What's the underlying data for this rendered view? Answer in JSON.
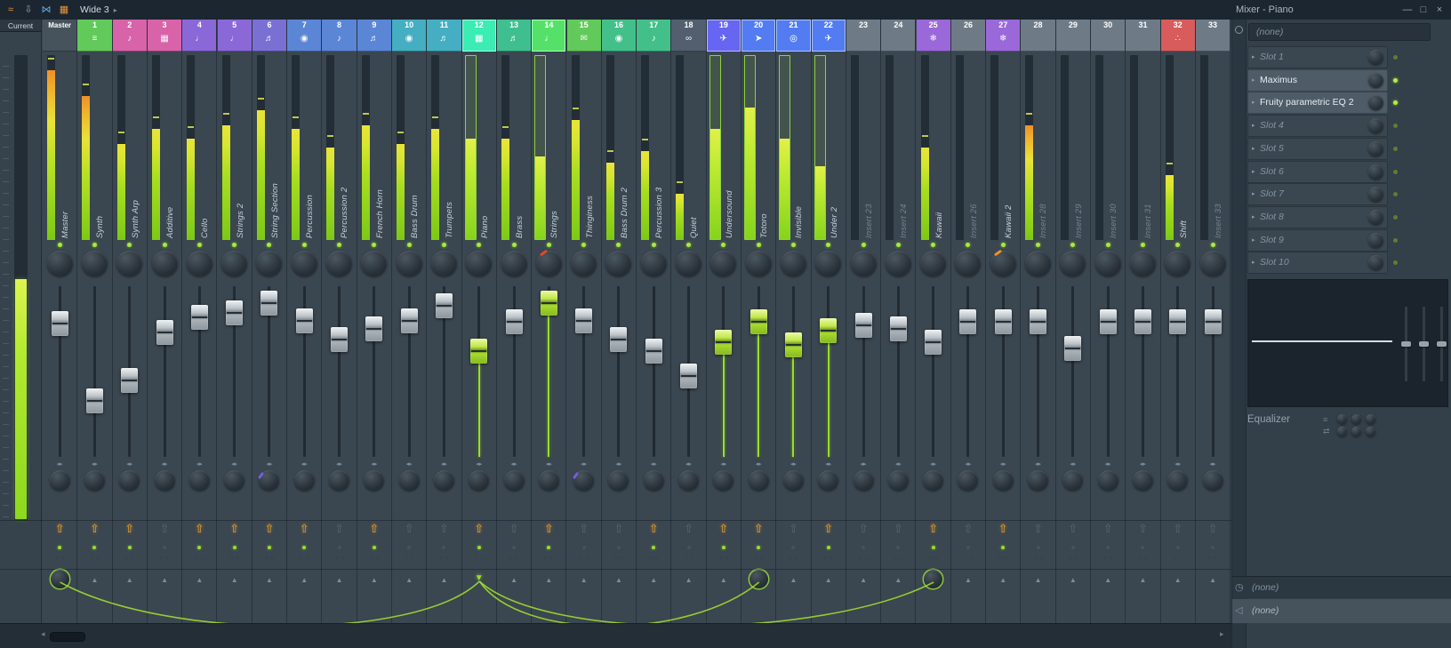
{
  "titlebar": {
    "preset": "Wide 3",
    "caret": "▸",
    "title": "Mixer - Piano",
    "tools": [
      {
        "name": "fl-logo-icon",
        "glyph": "≈",
        "color": "#e8953a"
      },
      {
        "name": "save-icon",
        "glyph": "⇩",
        "color": "#93a1ac"
      },
      {
        "name": "detach-icon",
        "glyph": "⋈",
        "color": "#64a8e0"
      },
      {
        "name": "layout-icon",
        "glyph": "▦",
        "color": "#e8953a"
      }
    ],
    "buttons": [
      {
        "name": "minimize-button",
        "glyph": "—"
      },
      {
        "name": "maximize-button",
        "glyph": "□"
      },
      {
        "name": "close-button",
        "glyph": "×"
      }
    ]
  },
  "colors": {
    "accent_green": "#9ade2e",
    "armed_orange": "#f2a32c",
    "cable_green": "#a6e22e",
    "selected_tab": "#35d4a0"
  },
  "current": {
    "label": "Current"
  },
  "channels": [
    {
      "num": "Master",
      "name": "Master",
      "color": "#46525c",
      "icon": "master-channel-icon",
      "glyph": "",
      "meter": 0.92,
      "hot": true,
      "fader": 0.83,
      "armed": true,
      "route": "knob"
    },
    {
      "num": "1",
      "name": "Synth",
      "color": "#62c95b",
      "icon": "synth-icon",
      "glyph": "≡",
      "meter": 0.78,
      "hot": true,
      "fader": 0.3,
      "armed": true
    },
    {
      "num": "2",
      "name": "Synth Arp",
      "color": "#d863a8",
      "icon": "arp-icon",
      "glyph": "♪",
      "meter": 0.52,
      "fader": 0.44,
      "armed": true
    },
    {
      "num": "3",
      "name": "Additive",
      "color": "#d863a8",
      "icon": "sequencer-icon",
      "glyph": "▦",
      "meter": 0.6,
      "fader": 0.77
    },
    {
      "num": "4",
      "name": "Cello",
      "color": "#8a68d8",
      "icon": "cello-icon",
      "glyph": "♩",
      "meter": 0.55,
      "fader": 0.87,
      "armed": true
    },
    {
      "num": "5",
      "name": "Strings 2",
      "color": "#8a68d8",
      "icon": "strings-icon",
      "glyph": "♩",
      "meter": 0.62,
      "fader": 0.9,
      "armed": true
    },
    {
      "num": "6",
      "name": "String Section",
      "color": "#7a70d4",
      "icon": "strings-icon",
      "glyph": "♬",
      "meter": 0.7,
      "fader": 0.97,
      "armed": true,
      "sep_mark": true
    },
    {
      "num": "7",
      "name": "Percussion",
      "color": "#5b86d6",
      "icon": "drum-icon",
      "glyph": "◉",
      "meter": 0.6,
      "fader": 0.85,
      "armed": true
    },
    {
      "num": "8",
      "name": "Percussion 2",
      "color": "#5b86d6",
      "icon": "percussion-icon",
      "glyph": "♪",
      "meter": 0.5,
      "fader": 0.72
    },
    {
      "num": "9",
      "name": "French Horn",
      "color": "#5b86d6",
      "icon": "horn-icon",
      "glyph": "♬",
      "meter": 0.62,
      "fader": 0.79,
      "armed": true
    },
    {
      "num": "10",
      "name": "Bass Drum",
      "color": "#45aec2",
      "icon": "drum-icon",
      "glyph": "◉",
      "meter": 0.52,
      "fader": 0.85
    },
    {
      "num": "11",
      "name": "Trumpets",
      "color": "#45aec2",
      "icon": "horn-icon",
      "glyph": "♬",
      "meter": 0.6,
      "fader": 0.95
    },
    {
      "num": "12",
      "name": "Piano",
      "color": "#35d4a0",
      "icon": "piano-icon",
      "glyph": "▦",
      "meter": 0.55,
      "selected": true,
      "fader": 0.64,
      "green": true,
      "armed": true,
      "route": "source"
    },
    {
      "num": "13",
      "name": "Brass",
      "color": "#3fbf8f",
      "icon": "horn-icon",
      "glyph": "♬",
      "meter": 0.55,
      "fader": 0.84
    },
    {
      "num": "14",
      "name": "Strings",
      "color": "#4cc95e",
      "icon": "strings-icon",
      "glyph": "♩",
      "meter": 0.45,
      "selected": true,
      "fader": 0.97,
      "green": true,
      "armed": true,
      "pan_mark": "#e04a28"
    },
    {
      "num": "15",
      "name": "Thinginess",
      "color": "#62c95b",
      "icon": "speech-icon",
      "glyph": "✉",
      "meter": 0.65,
      "fader": 0.85,
      "sep_mark": true
    },
    {
      "num": "16",
      "name": "Bass Drum 2",
      "color": "#43c08a",
      "icon": "drum-icon",
      "glyph": "◉",
      "meter": 0.42,
      "fader": 0.72
    },
    {
      "num": "17",
      "name": "Percussion 3",
      "color": "#43c08a",
      "icon": "percussion-icon",
      "glyph": "♪",
      "meter": 0.48,
      "fader": 0.64,
      "armed": true
    },
    {
      "num": "18",
      "name": "Quiet",
      "color": "#535f6e",
      "icon": "link-icon",
      "glyph": "∞",
      "meter": 0.25,
      "fader": 0.47
    },
    {
      "num": "19",
      "name": "Undersound",
      "color": "#5b5bd8",
      "icon": "plane-icon",
      "glyph": "✈",
      "meter": 0.6,
      "selected": true,
      "fader": 0.7,
      "green": true,
      "armed": true
    },
    {
      "num": "20",
      "name": "Totoro",
      "color": "#4a6fd8",
      "icon": "hand-icon",
      "glyph": "➤",
      "meter": 0.72,
      "selected": true,
      "fader": 0.84,
      "green": true,
      "armed": true,
      "route": "knob"
    },
    {
      "num": "21",
      "name": "Invisible",
      "color": "#4a6fd8",
      "icon": "eye-icon",
      "glyph": "◎",
      "meter": 0.55,
      "selected": true,
      "fader": 0.68,
      "green": true
    },
    {
      "num": "22",
      "name": "Under 2",
      "color": "#4a6fd8",
      "icon": "plane-icon",
      "glyph": "✈",
      "meter": 0.4,
      "selected": true,
      "fader": 0.78,
      "green": true,
      "armed": true
    },
    {
      "num": "23",
      "name": "Insert 23",
      "color": "#6e7b87",
      "icon": "",
      "glyph": "",
      "meter": 0,
      "fader": 0.82,
      "dim": true
    },
    {
      "num": "24",
      "name": "Insert 24",
      "color": "#6e7b87",
      "icon": "",
      "glyph": "",
      "meter": 0,
      "fader": 0.79,
      "dim": true
    },
    {
      "num": "25",
      "name": "Kawaii",
      "color": "#9a68d8",
      "icon": "snowflake-icon",
      "glyph": "❄",
      "meter": 0.5,
      "fader": 0.7,
      "armed": true,
      "route": "knob"
    },
    {
      "num": "26",
      "name": "Insert 26",
      "color": "#6e7b87",
      "icon": "",
      "glyph": "",
      "meter": 0,
      "fader": 0.84,
      "dim": true
    },
    {
      "num": "27",
      "name": "Kawaii 2",
      "color": "#9a68d8",
      "icon": "snowflake-icon",
      "glyph": "❄",
      "meter": 0,
      "fader": 0.84,
      "armed": true,
      "pan_mark": "#f09028"
    },
    {
      "num": "28",
      "name": "Insert 28",
      "color": "#6e7b87",
      "icon": "",
      "glyph": "",
      "meter": 0.62,
      "hot": true,
      "fader": 0.84,
      "dim": true
    },
    {
      "num": "29",
      "name": "Insert 29",
      "color": "#6e7b87",
      "icon": "",
      "glyph": "",
      "meter": 0,
      "fader": 0.66,
      "dim": true
    },
    {
      "num": "30",
      "name": "Insert 30",
      "color": "#6e7b87",
      "icon": "",
      "glyph": "",
      "meter": 0,
      "fader": 0.84,
      "dim": true
    },
    {
      "num": "31",
      "name": "Insert 31",
      "color": "#6e7b87",
      "icon": "",
      "glyph": "",
      "meter": 0,
      "fader": 0.84,
      "dim": true
    },
    {
      "num": "32",
      "name": "Shift",
      "color": "#d85c5c",
      "icon": "dots-icon",
      "glyph": "∴",
      "meter": 0.35,
      "fader": 0.84
    },
    {
      "num": "33",
      "name": "Insert 33",
      "color": "#6e7b87",
      "icon": "",
      "glyph": "",
      "meter": 0,
      "fader": 0.84,
      "dim": true
    }
  ],
  "sends": [
    {
      "from": 12,
      "to": 0
    },
    {
      "from": 12,
      "to": 20
    },
    {
      "from": 12,
      "to": 25
    }
  ],
  "panel": {
    "rack_selector": "(none)",
    "slots": [
      {
        "label": "Slot 1",
        "active": false
      },
      {
        "label": "Maximus",
        "active": true
      },
      {
        "label": "Fruity parametric EQ 2",
        "active": true
      },
      {
        "label": "Slot 4",
        "active": false
      },
      {
        "label": "Slot 5",
        "active": false
      },
      {
        "label": "Slot 6",
        "active": false
      },
      {
        "label": "Slot 7",
        "active": false
      },
      {
        "label": "Slot 8",
        "active": false
      },
      {
        "label": "Slot 9",
        "active": false
      },
      {
        "label": "Slot 10",
        "active": false
      }
    ],
    "equalizer_label": "Equalizer",
    "bottom": [
      {
        "icon": "clock-icon",
        "glyph": "◷",
        "label": "(none)"
      },
      {
        "icon": "speaker-icon",
        "glyph": "◁",
        "label": "(none)"
      }
    ]
  },
  "scrollbar": {
    "left_glyph": "◂",
    "right_glyph": "▸"
  }
}
